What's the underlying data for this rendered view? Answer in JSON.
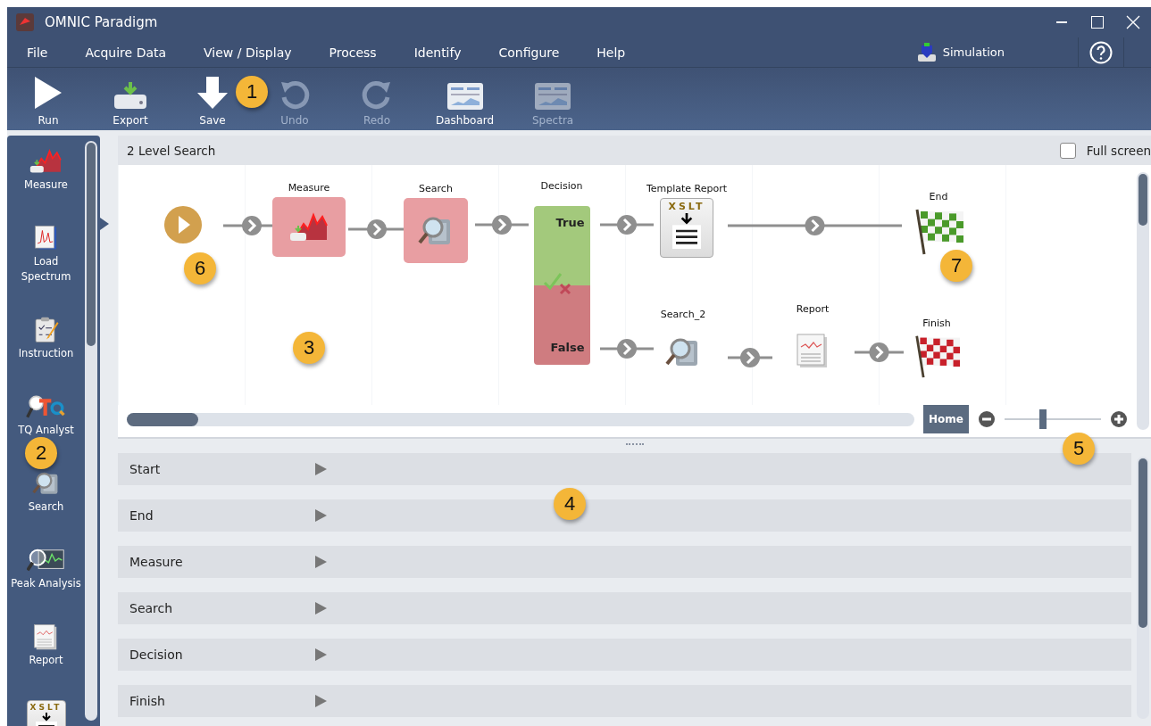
{
  "window": {
    "title": "OMNIC Paradigm"
  },
  "menu": [
    "File",
    "Acquire Data",
    "View / Display",
    "Process",
    "Identify",
    "Configure",
    "Help"
  ],
  "instrument": {
    "label": "Simulation"
  },
  "toolbar": [
    {
      "label": "Run",
      "kind": "run",
      "disabled": false
    },
    {
      "label": "Export",
      "kind": "export",
      "disabled": false
    },
    {
      "label": "Save",
      "kind": "save",
      "disabled": false
    },
    {
      "label": "Undo",
      "kind": "undo",
      "disabled": true
    },
    {
      "label": "Redo",
      "kind": "redo",
      "disabled": true
    },
    {
      "label": "Dashboard",
      "kind": "dashboard",
      "disabled": false
    },
    {
      "label": "Spectra",
      "kind": "dashboard",
      "disabled": true
    }
  ],
  "palette": [
    {
      "label": "Measure",
      "kind": "measure"
    },
    {
      "label": "Load Spectrum",
      "kind": "load"
    },
    {
      "label": "Instruction",
      "kind": "instruction"
    },
    {
      "label": "TQ Analyst",
      "kind": "tq"
    },
    {
      "label": "Search",
      "kind": "search"
    },
    {
      "label": "Peak Analysis",
      "kind": "peak"
    },
    {
      "label": "Report",
      "kind": "report"
    },
    {
      "kind": "xslt",
      "icon_text": "XSLT"
    }
  ],
  "workflow": {
    "title": "2 Level Search",
    "full_screen": {
      "label": "Full screen",
      "checked": false
    },
    "nodes": [
      {
        "kind": "start"
      },
      {
        "label": "Measure",
        "kind": "measure",
        "highlighted": true
      },
      {
        "label": "Search",
        "kind": "search",
        "highlighted": true
      },
      {
        "label": "Decision",
        "kind": "decision",
        "true_label": "True",
        "false_label": "False"
      },
      {
        "label": "Template Report",
        "kind": "xslt",
        "icon_text": "XSLT",
        "highlighted": false
      },
      {
        "label": "End",
        "kind": "end"
      },
      {
        "label": "Search_2",
        "kind": "search",
        "highlighted": false
      },
      {
        "label": "Report",
        "kind": "report",
        "highlighted": false
      },
      {
        "label": "Finish",
        "kind": "finish"
      }
    ],
    "home_button": "Home",
    "zoom": {
      "level": 0.4
    }
  },
  "properties": [
    {
      "label": "Start",
      "expanded": false
    },
    {
      "label": "End",
      "expanded": false
    },
    {
      "label": "Measure",
      "expanded": false
    },
    {
      "label": "Search",
      "expanded": false
    },
    {
      "label": "Decision",
      "expanded": false
    },
    {
      "label": "Finish",
      "expanded": false
    }
  ],
  "callouts": [
    "1",
    "2",
    "3",
    "4",
    "5",
    "6",
    "7"
  ]
}
